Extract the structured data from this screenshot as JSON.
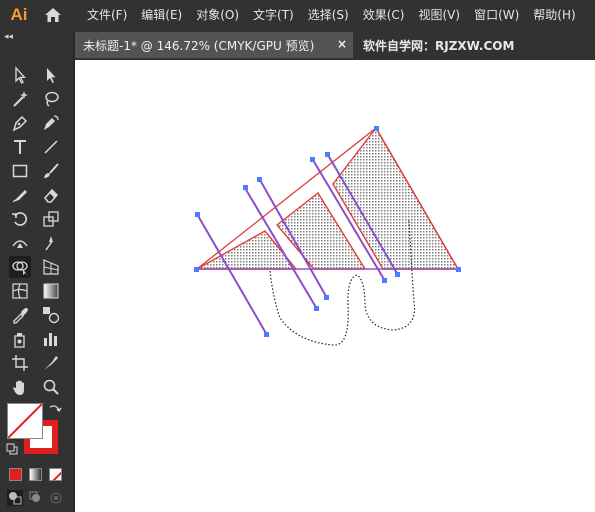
{
  "app": {
    "logo_text": "Ai",
    "logo_color": "#f79a2d"
  },
  "menu": {
    "items": [
      {
        "label": "文件(F)"
      },
      {
        "label": "编辑(E)"
      },
      {
        "label": "对象(O)"
      },
      {
        "label": "文字(T)"
      },
      {
        "label": "选择(S)"
      },
      {
        "label": "效果(C)"
      },
      {
        "label": "视图(V)"
      },
      {
        "label": "窗口(W)"
      },
      {
        "label": "帮助(H)"
      }
    ]
  },
  "tabs": {
    "document_title": "未标题-1* @ 146.72% (CMYK/GPU 预览)",
    "close_glyph": "×",
    "site_label": "软件自学网：RJZXW.COM"
  },
  "panel": {
    "collapse_glyph": "◂◂"
  },
  "toolbar": {
    "tools": [
      "selection-tool",
      "direct-selection-tool",
      "magic-wand-tool",
      "lasso-tool",
      "pen-tool",
      "curvature-tool",
      "type-tool",
      "line-segment-tool",
      "rectangle-tool",
      "paintbrush-tool",
      "shaper-tool",
      "eraser-tool",
      "rotate-tool",
      "scale-tool",
      "width-tool",
      "puppet-warp-tool",
      "shape-builder-tool",
      "perspective-grid-tool",
      "mesh-tool",
      "gradient-tool",
      "eyedropper-tool",
      "blend-tool",
      "symbol-sprayer-tool",
      "column-graph-tool",
      "artboard-tool",
      "slice-tool",
      "hand-tool",
      "zoom-tool"
    ],
    "active_tool": "shape-builder-tool",
    "fill_color": "#ffffff",
    "stroke_color": "#e02020"
  },
  "colors": {
    "chrome_dark": "#323232",
    "selection_blue": "#4a7cff",
    "artwork_red": "#e03c3c",
    "path_purple": "#8a4fc8"
  }
}
